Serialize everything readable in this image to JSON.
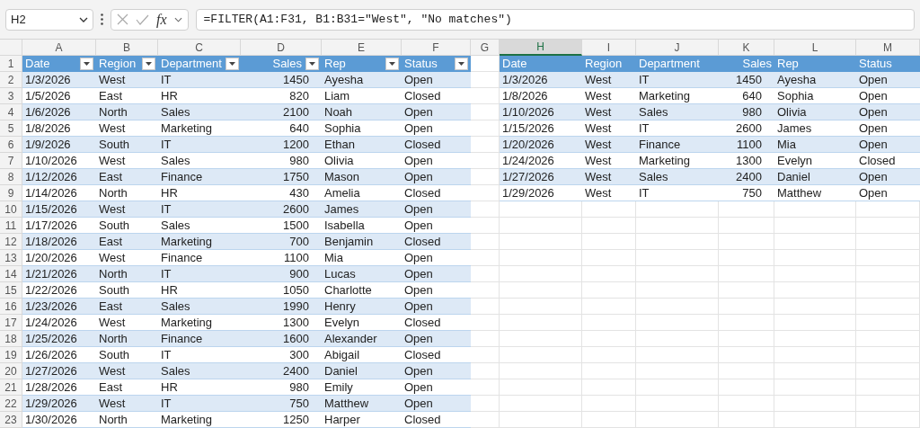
{
  "formula_bar": {
    "name_box": "H2",
    "fx_label": "fx",
    "formula": "=FILTER(A1:F31, B1:B31=\"West\", \"No matches\")"
  },
  "columns": [
    {
      "label": "A",
      "selected": false
    },
    {
      "label": "B",
      "selected": false
    },
    {
      "label": "C",
      "selected": false
    },
    {
      "label": "D",
      "selected": false
    },
    {
      "label": "E",
      "selected": false
    },
    {
      "label": "F",
      "selected": false
    },
    {
      "label": "G",
      "selected": false
    },
    {
      "label": "H",
      "selected": true
    },
    {
      "label": "I",
      "selected": false
    },
    {
      "label": "J",
      "selected": false
    },
    {
      "label": "K",
      "selected": false
    },
    {
      "label": "L",
      "selected": false
    },
    {
      "label": "M",
      "selected": false
    }
  ],
  "row_numbers": [
    "1",
    "2",
    "3",
    "4",
    "5",
    "6",
    "7",
    "8",
    "9",
    "10",
    "11",
    "12",
    "13",
    "14",
    "15",
    "16",
    "17",
    "18",
    "19",
    "20",
    "21",
    "22",
    "23"
  ],
  "source_table": {
    "headers": [
      "Date",
      "Region",
      "Department",
      "Sales",
      "Rep",
      "Status"
    ],
    "rows": [
      [
        "1/3/2026",
        "West",
        "IT",
        "1450",
        "Ayesha",
        "Open"
      ],
      [
        "1/5/2026",
        "East",
        "HR",
        "820",
        "Liam",
        "Closed"
      ],
      [
        "1/6/2026",
        "North",
        "Sales",
        "2100",
        "Noah",
        "Open"
      ],
      [
        "1/8/2026",
        "West",
        "Marketing",
        "640",
        "Sophia",
        "Open"
      ],
      [
        "1/9/2026",
        "South",
        "IT",
        "1200",
        "Ethan",
        "Closed"
      ],
      [
        "1/10/2026",
        "West",
        "Sales",
        "980",
        "Olivia",
        "Open"
      ],
      [
        "1/12/2026",
        "East",
        "Finance",
        "1750",
        "Mason",
        "Open"
      ],
      [
        "1/14/2026",
        "North",
        "HR",
        "430",
        "Amelia",
        "Closed"
      ],
      [
        "1/15/2026",
        "West",
        "IT",
        "2600",
        "James",
        "Open"
      ],
      [
        "1/17/2026",
        "South",
        "Sales",
        "1500",
        "Isabella",
        "Open"
      ],
      [
        "1/18/2026",
        "East",
        "Marketing",
        "700",
        "Benjamin",
        "Closed"
      ],
      [
        "1/20/2026",
        "West",
        "Finance",
        "1100",
        "Mia",
        "Open"
      ],
      [
        "1/21/2026",
        "North",
        "IT",
        "900",
        "Lucas",
        "Open"
      ],
      [
        "1/22/2026",
        "South",
        "HR",
        "1050",
        "Charlotte",
        "Open"
      ],
      [
        "1/23/2026",
        "East",
        "Sales",
        "1990",
        "Henry",
        "Open"
      ],
      [
        "1/24/2026",
        "West",
        "Marketing",
        "1300",
        "Evelyn",
        "Closed"
      ],
      [
        "1/25/2026",
        "North",
        "Finance",
        "1600",
        "Alexander",
        "Open"
      ],
      [
        "1/26/2026",
        "South",
        "IT",
        "300",
        "Abigail",
        "Closed"
      ],
      [
        "1/27/2026",
        "West",
        "Sales",
        "2400",
        "Daniel",
        "Open"
      ],
      [
        "1/28/2026",
        "East",
        "HR",
        "980",
        "Emily",
        "Open"
      ],
      [
        "1/29/2026",
        "West",
        "IT",
        "750",
        "Matthew",
        "Open"
      ],
      [
        "1/30/2026",
        "North",
        "Marketing",
        "1250",
        "Harper",
        "Closed"
      ]
    ]
  },
  "filtered_table": {
    "headers": [
      "Date",
      "Region",
      "Department",
      "Sales",
      "Rep",
      "Status"
    ],
    "rows": [
      [
        "1/3/2026",
        "West",
        "IT",
        "1450",
        "Ayesha",
        "Open"
      ],
      [
        "1/8/2026",
        "West",
        "Marketing",
        "640",
        "Sophia",
        "Open"
      ],
      [
        "1/10/2026",
        "West",
        "Sales",
        "980",
        "Olivia",
        "Open"
      ],
      [
        "1/15/2026",
        "West",
        "IT",
        "2600",
        "James",
        "Open"
      ],
      [
        "1/20/2026",
        "West",
        "Finance",
        "1100",
        "Mia",
        "Open"
      ],
      [
        "1/24/2026",
        "West",
        "Marketing",
        "1300",
        "Evelyn",
        "Closed"
      ],
      [
        "1/27/2026",
        "West",
        "Sales",
        "2400",
        "Daniel",
        "Open"
      ],
      [
        "1/29/2026",
        "West",
        "IT",
        "750",
        "Matthew",
        "Open"
      ]
    ]
  }
}
